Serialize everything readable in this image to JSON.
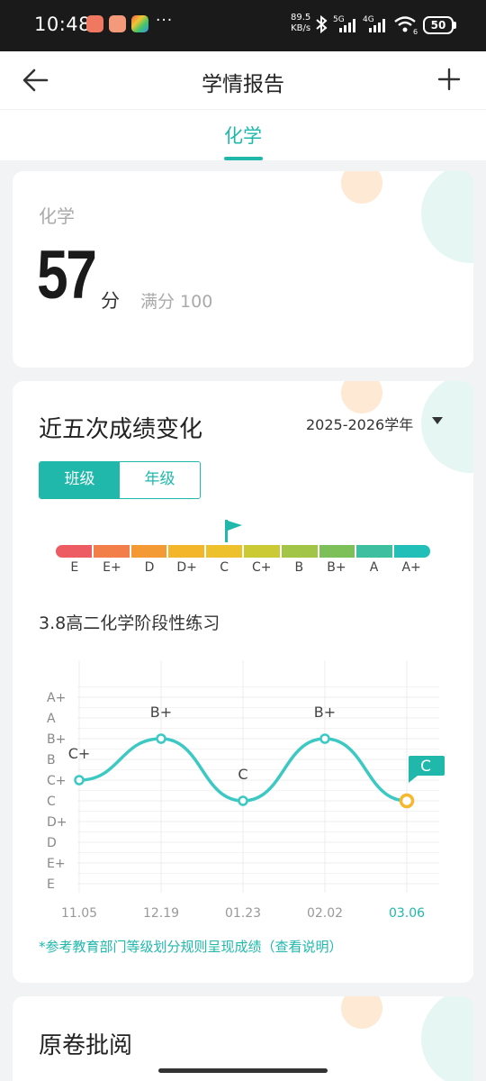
{
  "status_bar": {
    "time": "10:48",
    "more": "···",
    "net_speed_value": "89.5",
    "net_speed_unit": "KB/s",
    "signal_5g": "5G",
    "signal_4g": "4G",
    "wifi_num": "6",
    "battery": "50"
  },
  "header": {
    "title": "学情报告"
  },
  "tabs": {
    "active_label": "化学"
  },
  "score_card": {
    "subject": "化学",
    "score": "57",
    "unit": "分",
    "full_score": "满分 100"
  },
  "trend": {
    "title": "近五次成绩变化",
    "year": "2025-2026学年",
    "segments": [
      "班级",
      "年级"
    ],
    "grade_scale": [
      "E",
      "E+",
      "D",
      "D+",
      "C",
      "C+",
      "B",
      "B+",
      "A",
      "A+"
    ],
    "current_grade_index": 4,
    "exam_name": "3.8高二化学阶段性练习",
    "footnote": "*参考教育部门等级划分规则呈现成绩（查看说明）"
  },
  "colors": {
    "accent": "#1fb8ab",
    "line": "#3cc9c3",
    "highlight_point": "#f5b82e",
    "grade_gradient": [
      "#ee5c63",
      "#f27e4a",
      "#f39a34",
      "#f3b62a",
      "#ecc12b",
      "#cbc934",
      "#a2c447",
      "#7dc05a",
      "#3ebfa0",
      "#22bfb8"
    ]
  },
  "chart_data": {
    "type": "line",
    "y_categories": [
      "E",
      "E+",
      "D",
      "D+",
      "C",
      "C+",
      "B",
      "B+",
      "A",
      "A+"
    ],
    "x": [
      "11.05",
      "12.19",
      "01.23",
      "02.02",
      "03.06"
    ],
    "values": [
      "C+",
      "B+",
      "C",
      "B+",
      "C"
    ],
    "point_labels": [
      "C+",
      "B+",
      "C",
      "B+",
      "C"
    ],
    "highlight_index": 4,
    "grid": true
  },
  "review": {
    "title": "原卷批阅"
  }
}
